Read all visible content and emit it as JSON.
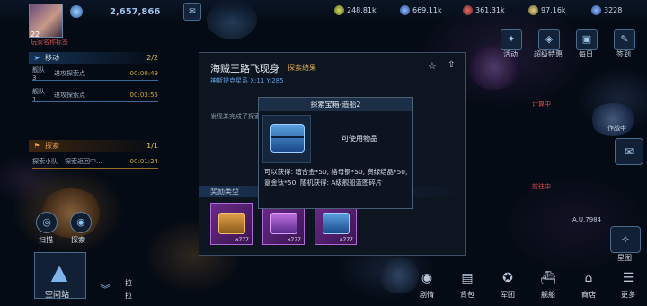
{
  "player": {
    "level": "22",
    "name_tag": "玩家名称标签",
    "currency": "2,657,866"
  },
  "resources": [
    "248.81k",
    "669.11k",
    "361.31k",
    "97.16k",
    "3228"
  ],
  "top_actions": [
    {
      "icon": "activity-icon",
      "label": "活动"
    },
    {
      "icon": "treasure-icon",
      "label": "超级特惠"
    },
    {
      "icon": "daily-icon",
      "label": "每日"
    },
    {
      "icon": "signin-icon",
      "label": "签到"
    }
  ],
  "left_panel": {
    "move_header": "移动",
    "move_count": "2/2",
    "move_rows": [
      {
        "fleet": "舰队3",
        "task": "进攻探索点",
        "time": "00:00:49"
      },
      {
        "fleet": "舰队1",
        "task": "进攻探索点",
        "time": "00:03:55"
      }
    ],
    "explore_header": "探索",
    "explore_count": "1/1",
    "explore_rows": [
      {
        "fleet": "探索小队",
        "task": "探索返回中...",
        "time": "00:01:24"
      }
    ]
  },
  "bottom_left": {
    "scan_label": "扫描",
    "explore_label": "探索",
    "station_label": "空间站",
    "side_label": "拉"
  },
  "dialog": {
    "title": "海贼王路飞现身",
    "subtitle": "探索结果",
    "location": "神斯提克星系 X:11 Y:285",
    "hint": "发现并完成了探索",
    "rewards_header": "奖励类型",
    "rewards": [
      {
        "count": "x777"
      },
      {
        "count": "x777"
      },
      {
        "count": "x777"
      }
    ]
  },
  "popup": {
    "title": "探索宝箱-造船2",
    "usable": "可使用物品",
    "description": "可以获得: 暗合金*50, 格母钢*50, 费绿结晶*50, 氪金钛*50, 随机获得: A级舰船蓝图碎片"
  },
  "right_side": {
    "tags": [
      "计算中",
      "作战中",
      "前往中"
    ],
    "coord": "A.U.7984",
    "map_label": "星图"
  },
  "bottom_nav": [
    {
      "icon": "story-icon",
      "label": "剧情"
    },
    {
      "icon": "bag-icon",
      "label": "背包"
    },
    {
      "icon": "army-icon",
      "label": "军团"
    },
    {
      "icon": "fleet-icon",
      "label": "舰船"
    },
    {
      "icon": "shop-icon",
      "label": "商店"
    },
    {
      "icon": "more-icon",
      "label": "更多"
    }
  ]
}
